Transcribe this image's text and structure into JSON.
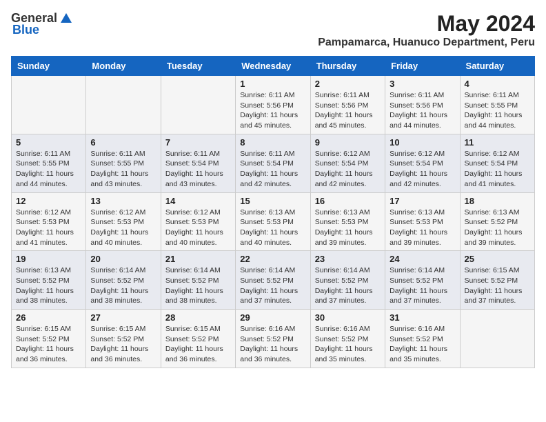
{
  "header": {
    "logo_general": "General",
    "logo_blue": "Blue",
    "month": "May 2024",
    "location": "Pampamarca, Huanuco Department, Peru"
  },
  "days_of_week": [
    "Sunday",
    "Monday",
    "Tuesday",
    "Wednesday",
    "Thursday",
    "Friday",
    "Saturday"
  ],
  "weeks": [
    [
      {
        "day": "",
        "info": ""
      },
      {
        "day": "",
        "info": ""
      },
      {
        "day": "",
        "info": ""
      },
      {
        "day": "1",
        "info": "Sunrise: 6:11 AM\nSunset: 5:56 PM\nDaylight: 11 hours\nand 45 minutes."
      },
      {
        "day": "2",
        "info": "Sunrise: 6:11 AM\nSunset: 5:56 PM\nDaylight: 11 hours\nand 45 minutes."
      },
      {
        "day": "3",
        "info": "Sunrise: 6:11 AM\nSunset: 5:56 PM\nDaylight: 11 hours\nand 44 minutes."
      },
      {
        "day": "4",
        "info": "Sunrise: 6:11 AM\nSunset: 5:55 PM\nDaylight: 11 hours\nand 44 minutes."
      }
    ],
    [
      {
        "day": "5",
        "info": "Sunrise: 6:11 AM\nSunset: 5:55 PM\nDaylight: 11 hours\nand 44 minutes."
      },
      {
        "day": "6",
        "info": "Sunrise: 6:11 AM\nSunset: 5:55 PM\nDaylight: 11 hours\nand 43 minutes."
      },
      {
        "day": "7",
        "info": "Sunrise: 6:11 AM\nSunset: 5:54 PM\nDaylight: 11 hours\nand 43 minutes."
      },
      {
        "day": "8",
        "info": "Sunrise: 6:11 AM\nSunset: 5:54 PM\nDaylight: 11 hours\nand 42 minutes."
      },
      {
        "day": "9",
        "info": "Sunrise: 6:12 AM\nSunset: 5:54 PM\nDaylight: 11 hours\nand 42 minutes."
      },
      {
        "day": "10",
        "info": "Sunrise: 6:12 AM\nSunset: 5:54 PM\nDaylight: 11 hours\nand 42 minutes."
      },
      {
        "day": "11",
        "info": "Sunrise: 6:12 AM\nSunset: 5:54 PM\nDaylight: 11 hours\nand 41 minutes."
      }
    ],
    [
      {
        "day": "12",
        "info": "Sunrise: 6:12 AM\nSunset: 5:53 PM\nDaylight: 11 hours\nand 41 minutes."
      },
      {
        "day": "13",
        "info": "Sunrise: 6:12 AM\nSunset: 5:53 PM\nDaylight: 11 hours\nand 40 minutes."
      },
      {
        "day": "14",
        "info": "Sunrise: 6:12 AM\nSunset: 5:53 PM\nDaylight: 11 hours\nand 40 minutes."
      },
      {
        "day": "15",
        "info": "Sunrise: 6:13 AM\nSunset: 5:53 PM\nDaylight: 11 hours\nand 40 minutes."
      },
      {
        "day": "16",
        "info": "Sunrise: 6:13 AM\nSunset: 5:53 PM\nDaylight: 11 hours\nand 39 minutes."
      },
      {
        "day": "17",
        "info": "Sunrise: 6:13 AM\nSunset: 5:53 PM\nDaylight: 11 hours\nand 39 minutes."
      },
      {
        "day": "18",
        "info": "Sunrise: 6:13 AM\nSunset: 5:52 PM\nDaylight: 11 hours\nand 39 minutes."
      }
    ],
    [
      {
        "day": "19",
        "info": "Sunrise: 6:13 AM\nSunset: 5:52 PM\nDaylight: 11 hours\nand 38 minutes."
      },
      {
        "day": "20",
        "info": "Sunrise: 6:14 AM\nSunset: 5:52 PM\nDaylight: 11 hours\nand 38 minutes."
      },
      {
        "day": "21",
        "info": "Sunrise: 6:14 AM\nSunset: 5:52 PM\nDaylight: 11 hours\nand 38 minutes."
      },
      {
        "day": "22",
        "info": "Sunrise: 6:14 AM\nSunset: 5:52 PM\nDaylight: 11 hours\nand 37 minutes."
      },
      {
        "day": "23",
        "info": "Sunrise: 6:14 AM\nSunset: 5:52 PM\nDaylight: 11 hours\nand 37 minutes."
      },
      {
        "day": "24",
        "info": "Sunrise: 6:14 AM\nSunset: 5:52 PM\nDaylight: 11 hours\nand 37 minutes."
      },
      {
        "day": "25",
        "info": "Sunrise: 6:15 AM\nSunset: 5:52 PM\nDaylight: 11 hours\nand 37 minutes."
      }
    ],
    [
      {
        "day": "26",
        "info": "Sunrise: 6:15 AM\nSunset: 5:52 PM\nDaylight: 11 hours\nand 36 minutes."
      },
      {
        "day": "27",
        "info": "Sunrise: 6:15 AM\nSunset: 5:52 PM\nDaylight: 11 hours\nand 36 minutes."
      },
      {
        "day": "28",
        "info": "Sunrise: 6:15 AM\nSunset: 5:52 PM\nDaylight: 11 hours\nand 36 minutes."
      },
      {
        "day": "29",
        "info": "Sunrise: 6:16 AM\nSunset: 5:52 PM\nDaylight: 11 hours\nand 36 minutes."
      },
      {
        "day": "30",
        "info": "Sunrise: 6:16 AM\nSunset: 5:52 PM\nDaylight: 11 hours\nand 35 minutes."
      },
      {
        "day": "31",
        "info": "Sunrise: 6:16 AM\nSunset: 5:52 PM\nDaylight: 11 hours\nand 35 minutes."
      },
      {
        "day": "",
        "info": ""
      }
    ]
  ]
}
